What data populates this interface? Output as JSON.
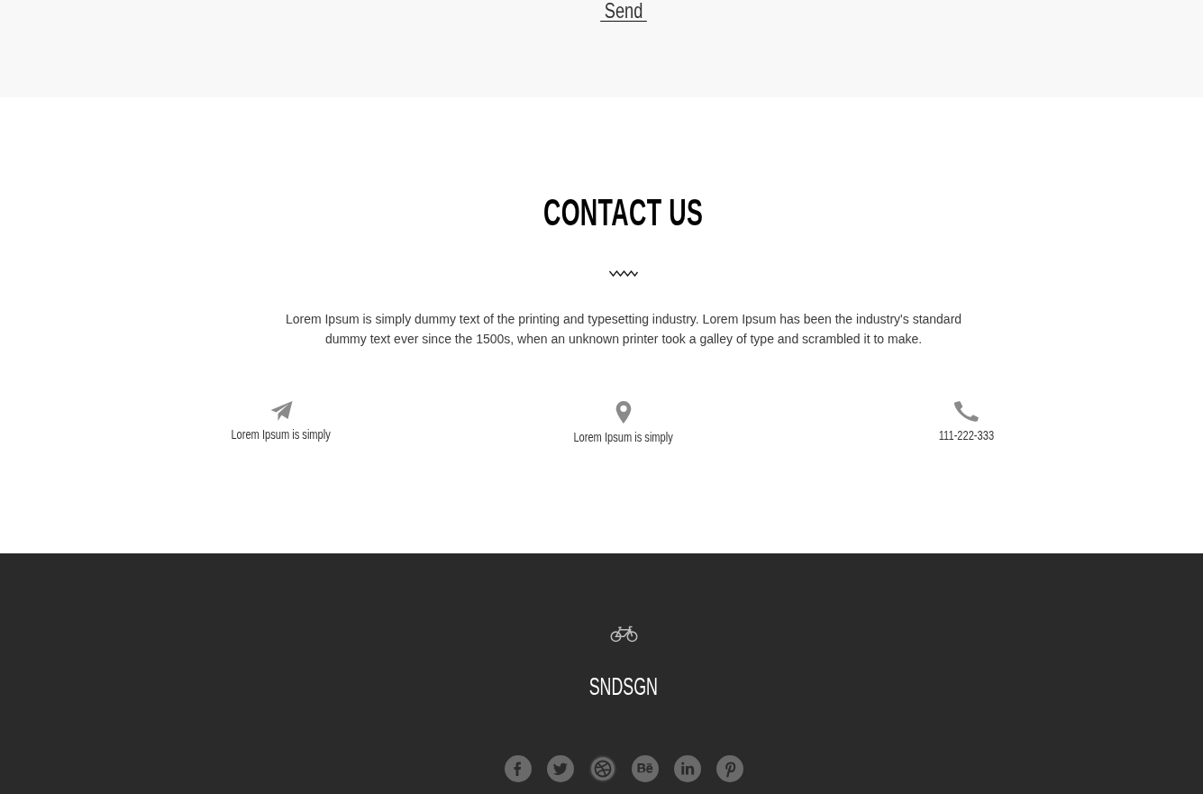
{
  "form": {
    "send_button": "Send"
  },
  "contact": {
    "title": "CONTACT US",
    "description": "Lorem Ipsum is simply dummy text of the printing and typesetting industry. Lorem Ipsum has been the industry's standard dummy text ever since the 1500s, when an unknown printer took a galley of type and scrambled it to make.",
    "items": [
      {
        "kind": "email",
        "text": "Lorem Ipsum is simply"
      },
      {
        "kind": "address",
        "text": "Lorem Ipsum is simply"
      },
      {
        "kind": "phone",
        "text": "111-222-333"
      }
    ]
  },
  "footer": {
    "brand": "SNDSGN"
  }
}
